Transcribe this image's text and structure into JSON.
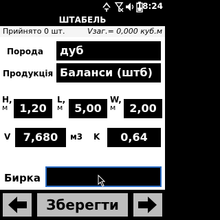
{
  "status": {
    "time": "18:24"
  },
  "header": {
    "title": "ШТАБЕЛЬ"
  },
  "info": {
    "accepted": "Прийнято 0 шт.",
    "volume_total": "Vзаг.= 0,000 куб.м"
  },
  "form": {
    "species": {
      "label": "Порода",
      "value": "дуб"
    },
    "product": {
      "label": "Продукція",
      "value": "Баланси (штб)"
    },
    "height": {
      "label_top": "H,",
      "label_bottom": "м",
      "value": "1,20"
    },
    "length": {
      "label_top": "L,",
      "label_bottom": "м",
      "value": "5,00"
    },
    "width": {
      "label_top": "W,",
      "label_bottom": "м",
      "value": "2,00"
    },
    "volume": {
      "label": "V",
      "value": "7,680",
      "unit": "м3"
    },
    "coefficient": {
      "label": "K",
      "value": "0,64"
    },
    "tag": {
      "label": "Бирка",
      "value": ""
    }
  },
  "footer": {
    "save_label": "Зберегти"
  },
  "colors": {
    "background": "#000000",
    "form_bg": "#ffffff",
    "button": "#bdbdbd",
    "focus_border": "#2b6cc4"
  }
}
